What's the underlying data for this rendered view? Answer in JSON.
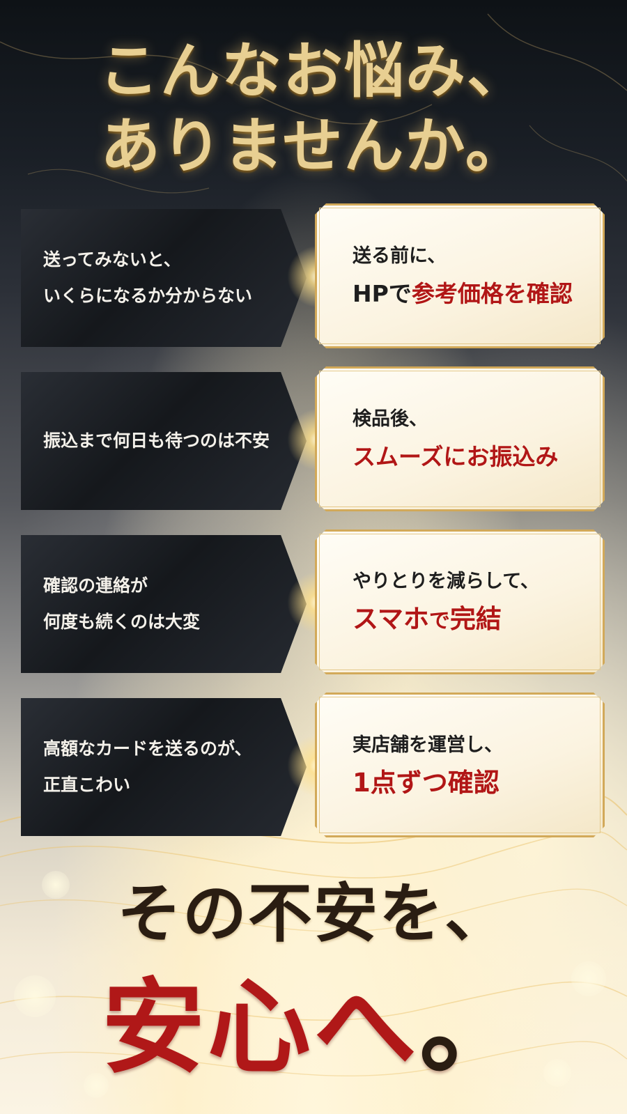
{
  "title": {
    "line1": "こんなお悩み、",
    "line2": "ありませんか。"
  },
  "rows": [
    {
      "concern": "送ってみないと、\nいくらになるか分からない",
      "solution_line1": "送る前に、",
      "solution_line2_plain": "HPで",
      "solution_line2_red": "参考価格を確認",
      "solution_line2_after": ""
    },
    {
      "concern": "振込まで何日も待つのは不安",
      "solution_line1": "検品後、",
      "solution_line2_plain": "",
      "solution_line2_red": "スムーズにお振込み",
      "solution_line2_after": ""
    },
    {
      "concern": "確認の連絡が\n何度も続くのは大変",
      "solution_line1": "やりとりを減らして、",
      "solution_line2_plain": "",
      "solution_line2_red": "スマホ",
      "solution_line2_mid": "で",
      "solution_line2_after": "完結"
    },
    {
      "concern": "高額なカードを送るのが、\n正直こわい",
      "solution_line1": "実店舗を運営し、",
      "solution_line2_plain": "",
      "solution_line2_red": "1点ずつ確認",
      "solution_line2_after": ""
    }
  ],
  "closing": {
    "line1": "その不安を、",
    "line2_red": "安心へ",
    "line2_period": "。"
  },
  "colors": {
    "accent_red": "#b11616",
    "gold": "#d2a959"
  }
}
